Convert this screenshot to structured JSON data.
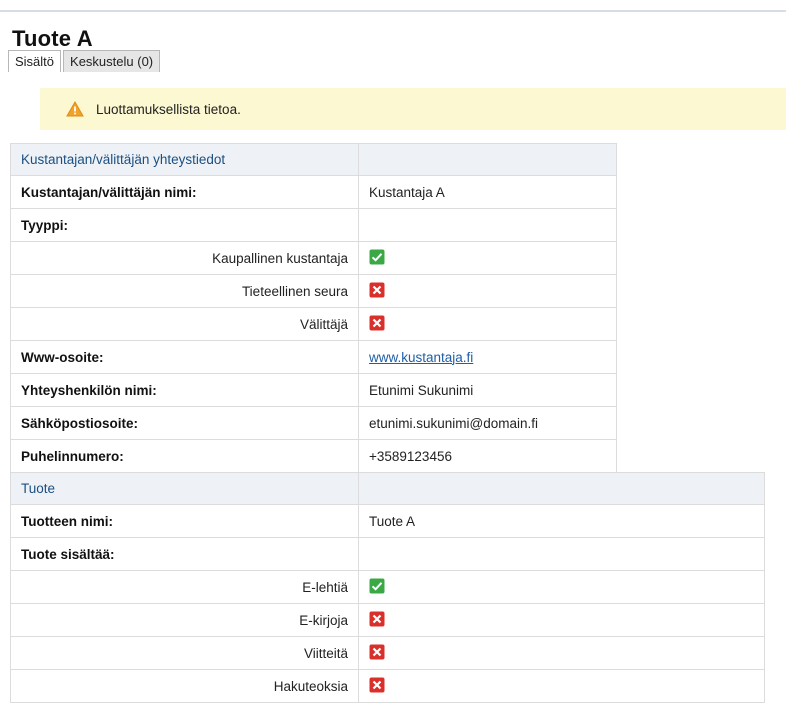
{
  "page": {
    "title": "Tuote A",
    "tabs": [
      {
        "label": "Sisältö",
        "active": true
      },
      {
        "label": "Keskustelu (0)",
        "active": false
      }
    ]
  },
  "alert": {
    "icon": "warning-icon",
    "text": "Luottamuksellista tietoa.",
    "color": "#fcf8d2"
  },
  "publisher": {
    "header": "Kustantajan/välittäjän yhteystiedot",
    "name_label": "Kustantajan/välittäjän nimi:",
    "name_value": "Kustantaja A",
    "type_label": "Tyyppi:",
    "types": [
      {
        "label": "Kaupallinen kustantaja",
        "checked": true
      },
      {
        "label": "Tieteellinen seura",
        "checked": false
      },
      {
        "label": "Välittäjä",
        "checked": false
      }
    ],
    "www_label": "Www-osoite:",
    "www_value": "www.kustantaja.fi",
    "contact_label": "Yhteyshenkilön nimi:",
    "contact_value": "Etunimi Sukunimi",
    "email_label": "Sähköpostiosoite:",
    "email_value": "etunimi.sukunimi@domain.fi",
    "phone_label": "Puhelinnumero:",
    "phone_value": "+3589123456"
  },
  "product": {
    "header": "Tuote",
    "name_label": "Tuotteen nimi:",
    "name_value": "Tuote A",
    "contains_label": "Tuote sisältää:",
    "contents": [
      {
        "label": "E-lehtiä",
        "checked": true
      },
      {
        "label": "E-kirjoja",
        "checked": false
      },
      {
        "label": "Viitteitä",
        "checked": false
      },
      {
        "label": "Hakuteoksia",
        "checked": false
      }
    ]
  },
  "colors": {
    "check_green": "#3aa845",
    "cross_red": "#d9302b",
    "header_bg": "#eef2f7",
    "header_text": "#1c4f80",
    "link": "#1f5ea8"
  }
}
